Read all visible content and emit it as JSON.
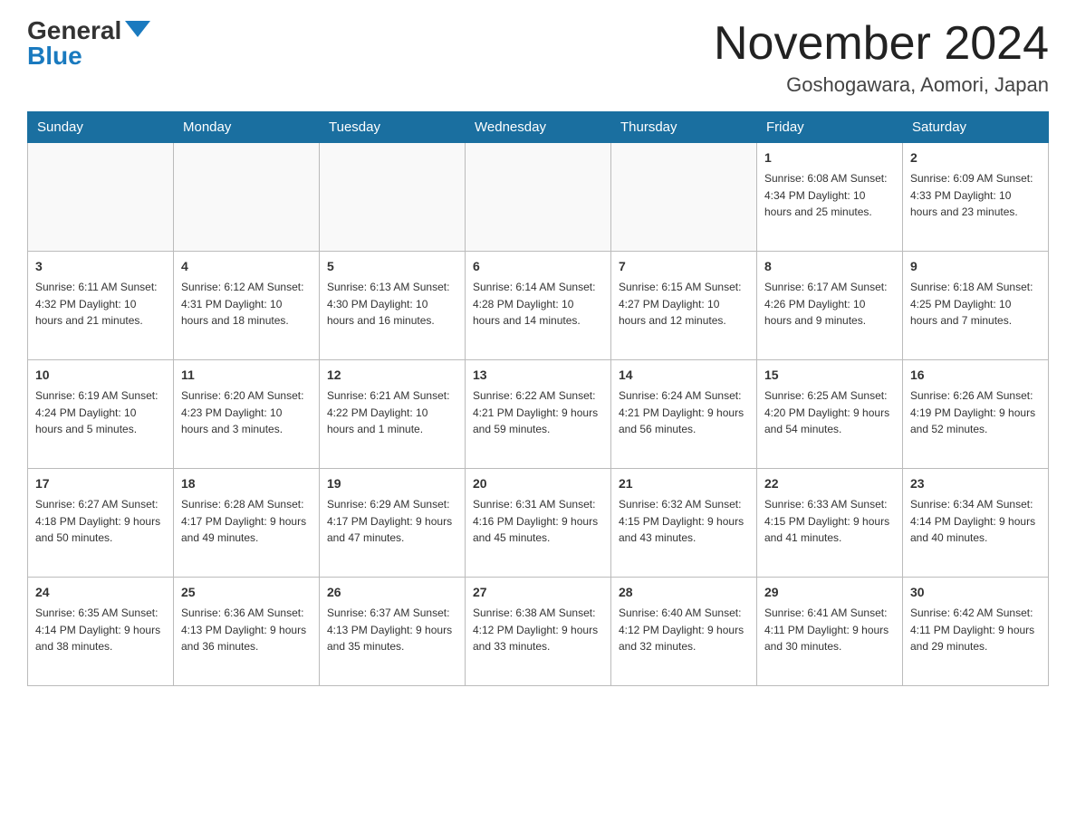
{
  "logo": {
    "general": "General",
    "blue": "Blue"
  },
  "header": {
    "month_title": "November 2024",
    "location": "Goshogawara, Aomori, Japan"
  },
  "weekdays": [
    "Sunday",
    "Monday",
    "Tuesday",
    "Wednesday",
    "Thursday",
    "Friday",
    "Saturday"
  ],
  "weeks": [
    [
      {
        "day": "",
        "content": ""
      },
      {
        "day": "",
        "content": ""
      },
      {
        "day": "",
        "content": ""
      },
      {
        "day": "",
        "content": ""
      },
      {
        "day": "",
        "content": ""
      },
      {
        "day": "1",
        "content": "Sunrise: 6:08 AM\nSunset: 4:34 PM\nDaylight: 10 hours and 25 minutes."
      },
      {
        "day": "2",
        "content": "Sunrise: 6:09 AM\nSunset: 4:33 PM\nDaylight: 10 hours and 23 minutes."
      }
    ],
    [
      {
        "day": "3",
        "content": "Sunrise: 6:11 AM\nSunset: 4:32 PM\nDaylight: 10 hours and 21 minutes."
      },
      {
        "day": "4",
        "content": "Sunrise: 6:12 AM\nSunset: 4:31 PM\nDaylight: 10 hours and 18 minutes."
      },
      {
        "day": "5",
        "content": "Sunrise: 6:13 AM\nSunset: 4:30 PM\nDaylight: 10 hours and 16 minutes."
      },
      {
        "day": "6",
        "content": "Sunrise: 6:14 AM\nSunset: 4:28 PM\nDaylight: 10 hours and 14 minutes."
      },
      {
        "day": "7",
        "content": "Sunrise: 6:15 AM\nSunset: 4:27 PM\nDaylight: 10 hours and 12 minutes."
      },
      {
        "day": "8",
        "content": "Sunrise: 6:17 AM\nSunset: 4:26 PM\nDaylight: 10 hours and 9 minutes."
      },
      {
        "day": "9",
        "content": "Sunrise: 6:18 AM\nSunset: 4:25 PM\nDaylight: 10 hours and 7 minutes."
      }
    ],
    [
      {
        "day": "10",
        "content": "Sunrise: 6:19 AM\nSunset: 4:24 PM\nDaylight: 10 hours and 5 minutes."
      },
      {
        "day": "11",
        "content": "Sunrise: 6:20 AM\nSunset: 4:23 PM\nDaylight: 10 hours and 3 minutes."
      },
      {
        "day": "12",
        "content": "Sunrise: 6:21 AM\nSunset: 4:22 PM\nDaylight: 10 hours and 1 minute."
      },
      {
        "day": "13",
        "content": "Sunrise: 6:22 AM\nSunset: 4:21 PM\nDaylight: 9 hours and 59 minutes."
      },
      {
        "day": "14",
        "content": "Sunrise: 6:24 AM\nSunset: 4:21 PM\nDaylight: 9 hours and 56 minutes."
      },
      {
        "day": "15",
        "content": "Sunrise: 6:25 AM\nSunset: 4:20 PM\nDaylight: 9 hours and 54 minutes."
      },
      {
        "day": "16",
        "content": "Sunrise: 6:26 AM\nSunset: 4:19 PM\nDaylight: 9 hours and 52 minutes."
      }
    ],
    [
      {
        "day": "17",
        "content": "Sunrise: 6:27 AM\nSunset: 4:18 PM\nDaylight: 9 hours and 50 minutes."
      },
      {
        "day": "18",
        "content": "Sunrise: 6:28 AM\nSunset: 4:17 PM\nDaylight: 9 hours and 49 minutes."
      },
      {
        "day": "19",
        "content": "Sunrise: 6:29 AM\nSunset: 4:17 PM\nDaylight: 9 hours and 47 minutes."
      },
      {
        "day": "20",
        "content": "Sunrise: 6:31 AM\nSunset: 4:16 PM\nDaylight: 9 hours and 45 minutes."
      },
      {
        "day": "21",
        "content": "Sunrise: 6:32 AM\nSunset: 4:15 PM\nDaylight: 9 hours and 43 minutes."
      },
      {
        "day": "22",
        "content": "Sunrise: 6:33 AM\nSunset: 4:15 PM\nDaylight: 9 hours and 41 minutes."
      },
      {
        "day": "23",
        "content": "Sunrise: 6:34 AM\nSunset: 4:14 PM\nDaylight: 9 hours and 40 minutes."
      }
    ],
    [
      {
        "day": "24",
        "content": "Sunrise: 6:35 AM\nSunset: 4:14 PM\nDaylight: 9 hours and 38 minutes."
      },
      {
        "day": "25",
        "content": "Sunrise: 6:36 AM\nSunset: 4:13 PM\nDaylight: 9 hours and 36 minutes."
      },
      {
        "day": "26",
        "content": "Sunrise: 6:37 AM\nSunset: 4:13 PM\nDaylight: 9 hours and 35 minutes."
      },
      {
        "day": "27",
        "content": "Sunrise: 6:38 AM\nSunset: 4:12 PM\nDaylight: 9 hours and 33 minutes."
      },
      {
        "day": "28",
        "content": "Sunrise: 6:40 AM\nSunset: 4:12 PM\nDaylight: 9 hours and 32 minutes."
      },
      {
        "day": "29",
        "content": "Sunrise: 6:41 AM\nSunset: 4:11 PM\nDaylight: 9 hours and 30 minutes."
      },
      {
        "day": "30",
        "content": "Sunrise: 6:42 AM\nSunset: 4:11 PM\nDaylight: 9 hours and 29 minutes."
      }
    ]
  ]
}
